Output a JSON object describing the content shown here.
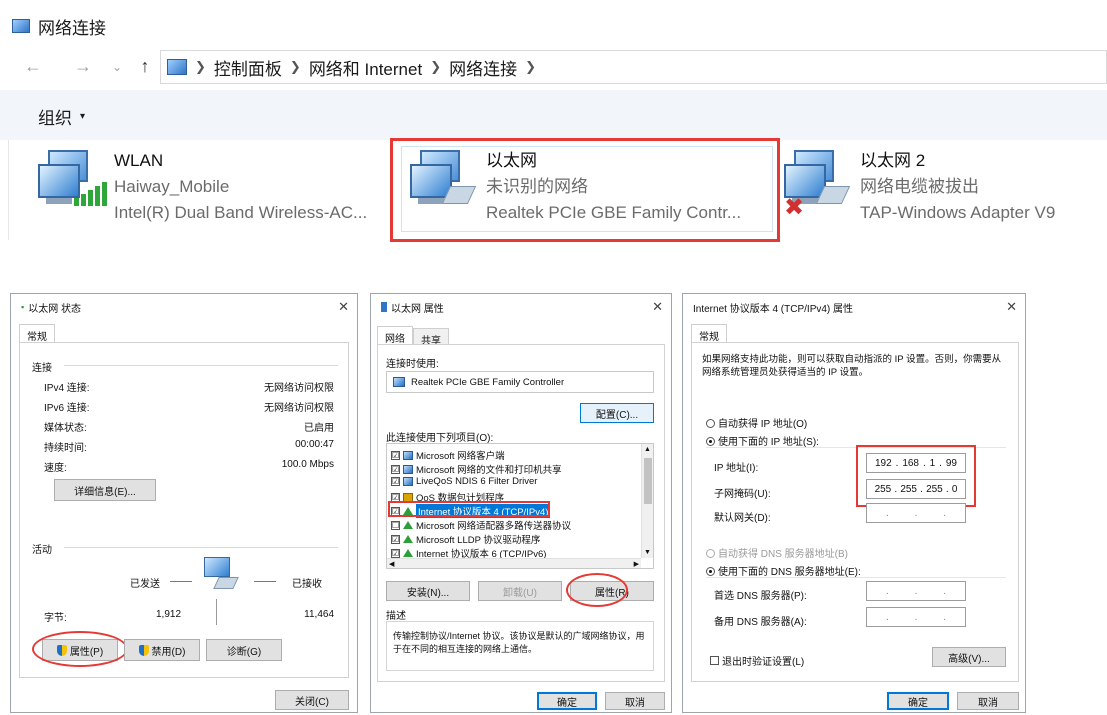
{
  "explorer": {
    "window_title": "网络连接",
    "breadcrumbs": [
      "控制面板",
      "网络和 Internet",
      "网络连接"
    ],
    "organize_label": "组织",
    "items": [
      {
        "name": "WLAN",
        "status": "Haiway_Mobile",
        "device": "Intel(R) Dual Band Wireless-AC..."
      },
      {
        "name": "以太网",
        "status": "未识别的网络",
        "device": "Realtek PCIe GBE Family Contr..."
      },
      {
        "name": "以太网 2",
        "status": "网络电缆被拔出",
        "device": "TAP-Windows Adapter V9"
      }
    ]
  },
  "status_dialog": {
    "title": "以太网 状态",
    "tab": "常规",
    "section_connection": "连接",
    "rows": [
      {
        "label": "IPv4 连接:",
        "value": "无网络访问权限"
      },
      {
        "label": "IPv6 连接:",
        "value": "无网络访问权限"
      },
      {
        "label": "媒体状态:",
        "value": "已启用"
      },
      {
        "label": "持续时间:",
        "value": "00:00:47"
      },
      {
        "label": "速度:",
        "value": "100.0 Mbps"
      }
    ],
    "details_button": "详细信息(E)...",
    "section_activity": "活动",
    "sent_label": "已发送",
    "received_label": "已接收",
    "bytes_label": "字节:",
    "bytes_sent": "1,912",
    "bytes_received": "11,464",
    "properties_button": "属性(P)",
    "disable_button": "禁用(D)",
    "diagnose_button": "诊断(G)",
    "close_button": "关闭(C)"
  },
  "properties_dialog": {
    "title": "以太网 属性",
    "tabs": [
      "网络",
      "共享"
    ],
    "connect_using_label": "连接时使用:",
    "adapter_name": "Realtek PCIe GBE Family Controller",
    "configure_button": "配置(C)...",
    "items_label": "此连接使用下列项目(O):",
    "items": [
      {
        "label": "Microsoft 网络客户端",
        "checked": "☑"
      },
      {
        "label": "Microsoft 网络的文件和打印机共享",
        "checked": "☑"
      },
      {
        "label": "LiveQoS NDIS 6 Filter Driver",
        "checked": "☑"
      },
      {
        "label": "QoS 数据包计划程序",
        "checked": "☑"
      },
      {
        "label": "Internet 协议版本 4 (TCP/IPv4)",
        "checked": "☑"
      },
      {
        "label": "Microsoft 网络适配器多路传送器协议",
        "checked": "☐"
      },
      {
        "label": "Microsoft LLDP 协议驱动程序",
        "checked": "☑"
      },
      {
        "label": "Internet 协议版本 6 (TCP/IPv6)",
        "checked": "☑"
      }
    ],
    "install_button": "安装(N)...",
    "uninstall_button": "卸载(U)",
    "properties_button": "属性(R)",
    "description_label": "描述",
    "description_text": "传输控制协议/Internet 协议。该协议是默认的广域网络协议，用于在不同的相互连接的网络上通信。",
    "ok_button": "确定",
    "cancel_button": "取消"
  },
  "ipv4_dialog": {
    "title": "Internet 协议版本 4 (TCP/IPv4) 属性",
    "tab": "常规",
    "intro": "如果网络支持此功能，则可以获取自动指派的 IP 设置。否则，你需要从网络系统管理员处获得适当的 IP 设置。",
    "auto_ip": "自动获得 IP 地址(O)",
    "manual_ip": "使用下面的 IP 地址(S):",
    "ip_label": "IP 地址(I):",
    "ip_value": [
      "192",
      "168",
      "1",
      "99"
    ],
    "mask_label": "子网掩码(U):",
    "mask_value": [
      "255",
      "255",
      "255",
      "0"
    ],
    "gateway_label": "默认网关(D):",
    "auto_dns": "自动获得 DNS 服务器地址(B)",
    "manual_dns": "使用下面的 DNS 服务器地址(E):",
    "dns1_label": "首选 DNS 服务器(P):",
    "dns2_label": "备用 DNS 服务器(A):",
    "validate_label": "退出时验证设置(L)",
    "advanced_button": "高级(V)...",
    "ok_button": "确定",
    "cancel_button": "取消"
  },
  "colors": {
    "accent": "#0078d7",
    "highlight_red": "#e53935"
  }
}
